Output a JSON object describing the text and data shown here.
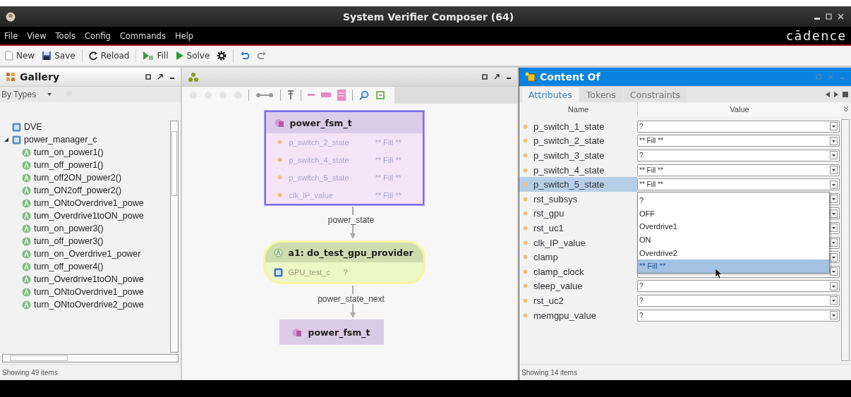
{
  "window": {
    "title": "System Verifier Composer (64)",
    "logo": "cādence"
  },
  "menu": [
    "File",
    "View",
    "Tools",
    "Config",
    "Commands",
    "Help"
  ],
  "toolbar": [
    {
      "kind": "new",
      "label": "New"
    },
    {
      "kind": "save",
      "label": "Save"
    },
    {
      "kind": "reload",
      "label": "Reload"
    },
    {
      "kind": "fill",
      "label": "Fill"
    },
    {
      "kind": "solve",
      "label": "Solve"
    },
    {
      "kind": "gear"
    },
    {
      "kind": "undo"
    },
    {
      "kind": "redo"
    }
  ],
  "gallery": {
    "title": "Gallery",
    "filter": "By Types",
    "status": "Showing 49 items",
    "tree": [
      {
        "label": "DVE",
        "kind": "class"
      },
      {
        "label": "power_manager_c",
        "kind": "class",
        "expanded": true,
        "children": [
          {
            "label": "turn_on_power1()",
            "kind": "action"
          },
          {
            "label": "turn_off_power1()",
            "kind": "action"
          },
          {
            "label": "turn_off2ON_power2()",
            "kind": "action"
          },
          {
            "label": "turn_ON2off_power2()",
            "kind": "action"
          },
          {
            "label": "turn_ONtoOverdrive1_powe",
            "kind": "action"
          },
          {
            "label": "turn_Overdrive1toON_powe",
            "kind": "action"
          },
          {
            "label": "turn_on_power3()",
            "kind": "action"
          },
          {
            "label": "turn_off_power3()",
            "kind": "action"
          },
          {
            "label": "turn_on_Overdrive1_power",
            "kind": "action"
          },
          {
            "label": "turn_off_power4()",
            "kind": "action"
          },
          {
            "label": "turn_Overdrive1toON_powe",
            "kind": "action"
          },
          {
            "label": "turn_ONtoOverdrive1_powe",
            "kind": "action"
          },
          {
            "label": "turn_ONtoOverdrive2_powe",
            "kind": "action"
          }
        ]
      }
    ]
  },
  "diagram": {
    "nodes": [
      {
        "kind": "struct",
        "title": "power_fsm_t",
        "selected": true,
        "fields": [
          {
            "name": "p_switch_2_state",
            "value": "** Fill **"
          },
          {
            "name": "p_switch_4_state",
            "value": "** Fill **"
          },
          {
            "name": "p_switch_5_state",
            "value": "** Fill **"
          },
          {
            "name": "clk_IP_value",
            "value": "** Fill **"
          }
        ],
        "edge_label": "power_state"
      },
      {
        "kind": "action",
        "title": "a1: do_test_gpu_provider",
        "fields": [
          {
            "name": "GPU_test_c",
            "value": "?"
          }
        ],
        "edge_label": "power_state_next"
      },
      {
        "kind": "struct",
        "title": "power_fsm_t",
        "selected": false
      }
    ]
  },
  "content": {
    "title": "Content Of",
    "status": "Showing 14 items",
    "tabs": [
      {
        "label": "Attributes",
        "selected": true
      },
      {
        "label": "Tokens",
        "selected": false
      },
      {
        "label": "Constraints",
        "selected": false
      }
    ],
    "columns": [
      "Name",
      "Value"
    ],
    "rows": [
      {
        "name": "p_switch_1_state",
        "value": "?",
        "selected": false
      },
      {
        "name": "p_switch_2_state",
        "value": "** Fill **",
        "selected": false
      },
      {
        "name": "p_switch_3_state",
        "value": "?",
        "selected": false
      },
      {
        "name": "p_switch_4_state",
        "value": "** Fill **",
        "selected": false
      },
      {
        "name": "p_switch_5_state",
        "value": "** Fill **",
        "selected": true
      },
      {
        "name": "rst_subsys",
        "selected": false
      },
      {
        "name": "rst_gpu",
        "selected": false
      },
      {
        "name": "rst_uc1",
        "selected": false
      },
      {
        "name": "clk_IP_value",
        "selected": false
      },
      {
        "name": "clamp",
        "selected": false
      },
      {
        "name": "clamp_clock",
        "selected": false
      },
      {
        "name": "sleep_value",
        "value": "?",
        "selected": false
      },
      {
        "name": "rst_uc2",
        "value": "?",
        "selected": false
      },
      {
        "name": "memgpu_value",
        "value": "?",
        "selected": false
      }
    ],
    "options": [
      {
        "label": "?",
        "selected": false
      },
      {
        "label": "OFF",
        "selected": false
      },
      {
        "label": "Overdrive1",
        "selected": false
      },
      {
        "label": "ON",
        "selected": false
      },
      {
        "label": "Overdrive2",
        "selected": false
      },
      {
        "label": "** Fill **",
        "selected": true
      }
    ]
  }
}
